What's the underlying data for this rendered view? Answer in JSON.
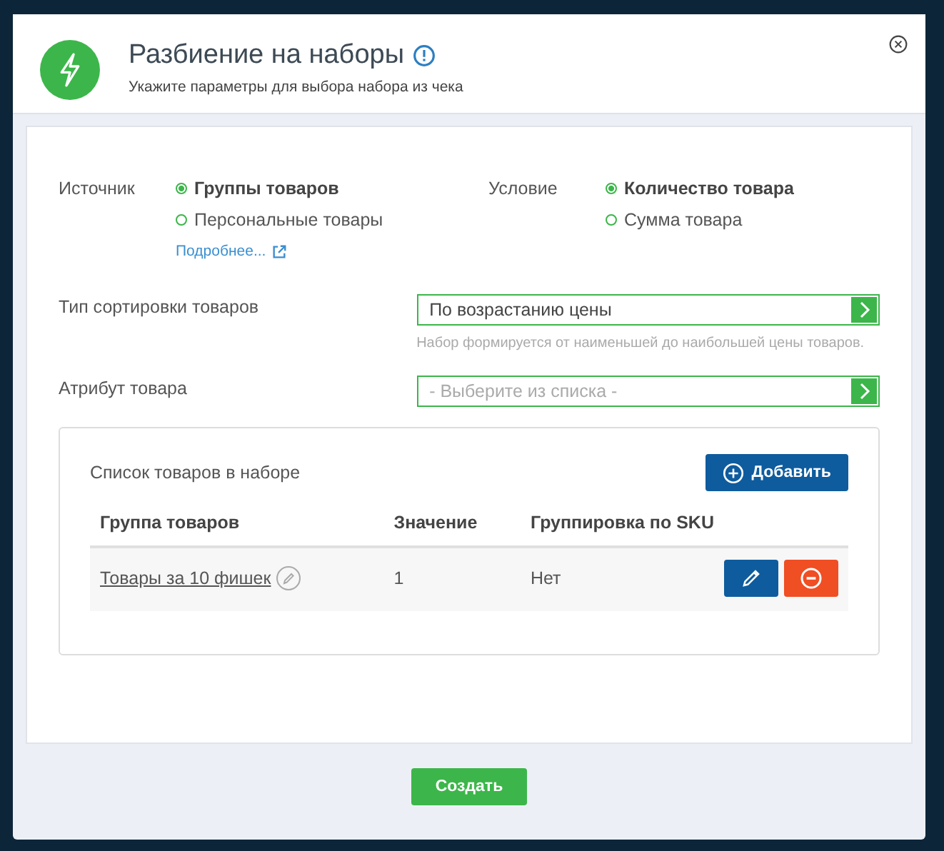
{
  "dialog": {
    "title": "Разбиение на наборы",
    "subtitle": "Укажите параметры для выбора набора из чека"
  },
  "source": {
    "label": "Источник",
    "options": [
      {
        "label": "Группы товаров",
        "selected": true
      },
      {
        "label": "Персональные товары",
        "selected": false
      }
    ],
    "link": "Подробнее..."
  },
  "condition": {
    "label": "Условие",
    "options": [
      {
        "label": "Количество товара",
        "selected": true
      },
      {
        "label": "Сумма товара",
        "selected": false
      }
    ]
  },
  "fields": [
    {
      "label": "Тип сортировки товаров",
      "value": "По возрастанию цены",
      "hint": "Набор формируется от наименьшей до наибольшей цены товаров."
    },
    {
      "label": "Атрибут товара",
      "placeholder": "- Выберите из списка -"
    }
  ],
  "set_list": {
    "title": "Список товаров в наборе",
    "add_button": "Добавить",
    "columns": [
      "Группа товаров",
      "Значение",
      "Группировка по SKU"
    ],
    "rows": [
      {
        "group": "Товары за 10 фишек",
        "value": "1",
        "sku": "Нет"
      }
    ]
  },
  "create_button": "Создать"
}
